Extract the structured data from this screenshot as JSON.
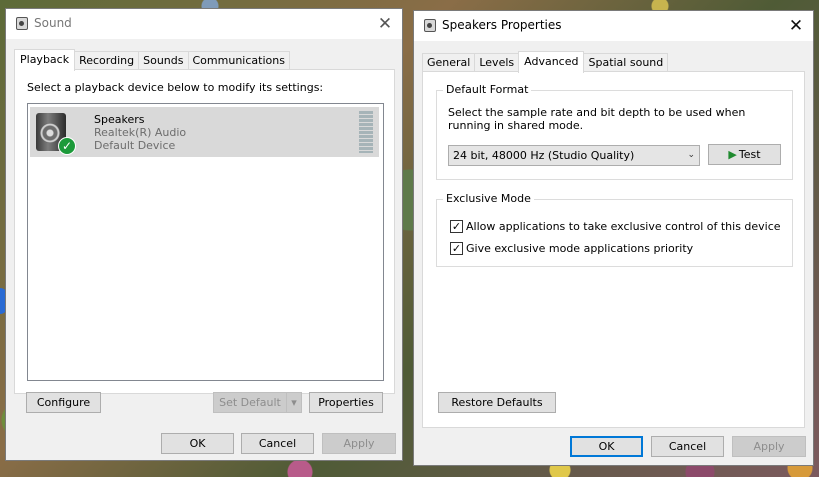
{
  "sound": {
    "title": "Sound",
    "tabs": [
      "Playback",
      "Recording",
      "Sounds",
      "Communications"
    ],
    "instruction": "Select a playback device below to modify its settings:",
    "device": {
      "name": "Speakers",
      "driver": "Realtek(R) Audio",
      "status": "Default Device"
    },
    "buttons": {
      "configure": "Configure",
      "set_default": "Set Default",
      "properties": "Properties",
      "ok": "OK",
      "cancel": "Cancel",
      "apply": "Apply"
    }
  },
  "props": {
    "title": "Speakers Properties",
    "tabs": [
      "General",
      "Levels",
      "Advanced",
      "Spatial sound"
    ],
    "default_format": {
      "label": "Default Format",
      "description": "Select the sample rate and bit depth to be used when running in shared mode.",
      "selected": "24 bit, 48000 Hz (Studio Quality)",
      "test_label": "Test"
    },
    "exclusive": {
      "label": "Exclusive Mode",
      "allow_label": "Allow applications to take exclusive control of this device",
      "allow_checked": true,
      "priority_label": "Give exclusive mode applications priority",
      "priority_checked": true
    },
    "buttons": {
      "restore": "Restore Defaults",
      "ok": "OK",
      "cancel": "Cancel",
      "apply": "Apply"
    }
  },
  "icons": {
    "close": "close-icon",
    "check": "checkmark-icon",
    "play": "play-icon",
    "dropdown": "chevron-down-icon"
  }
}
